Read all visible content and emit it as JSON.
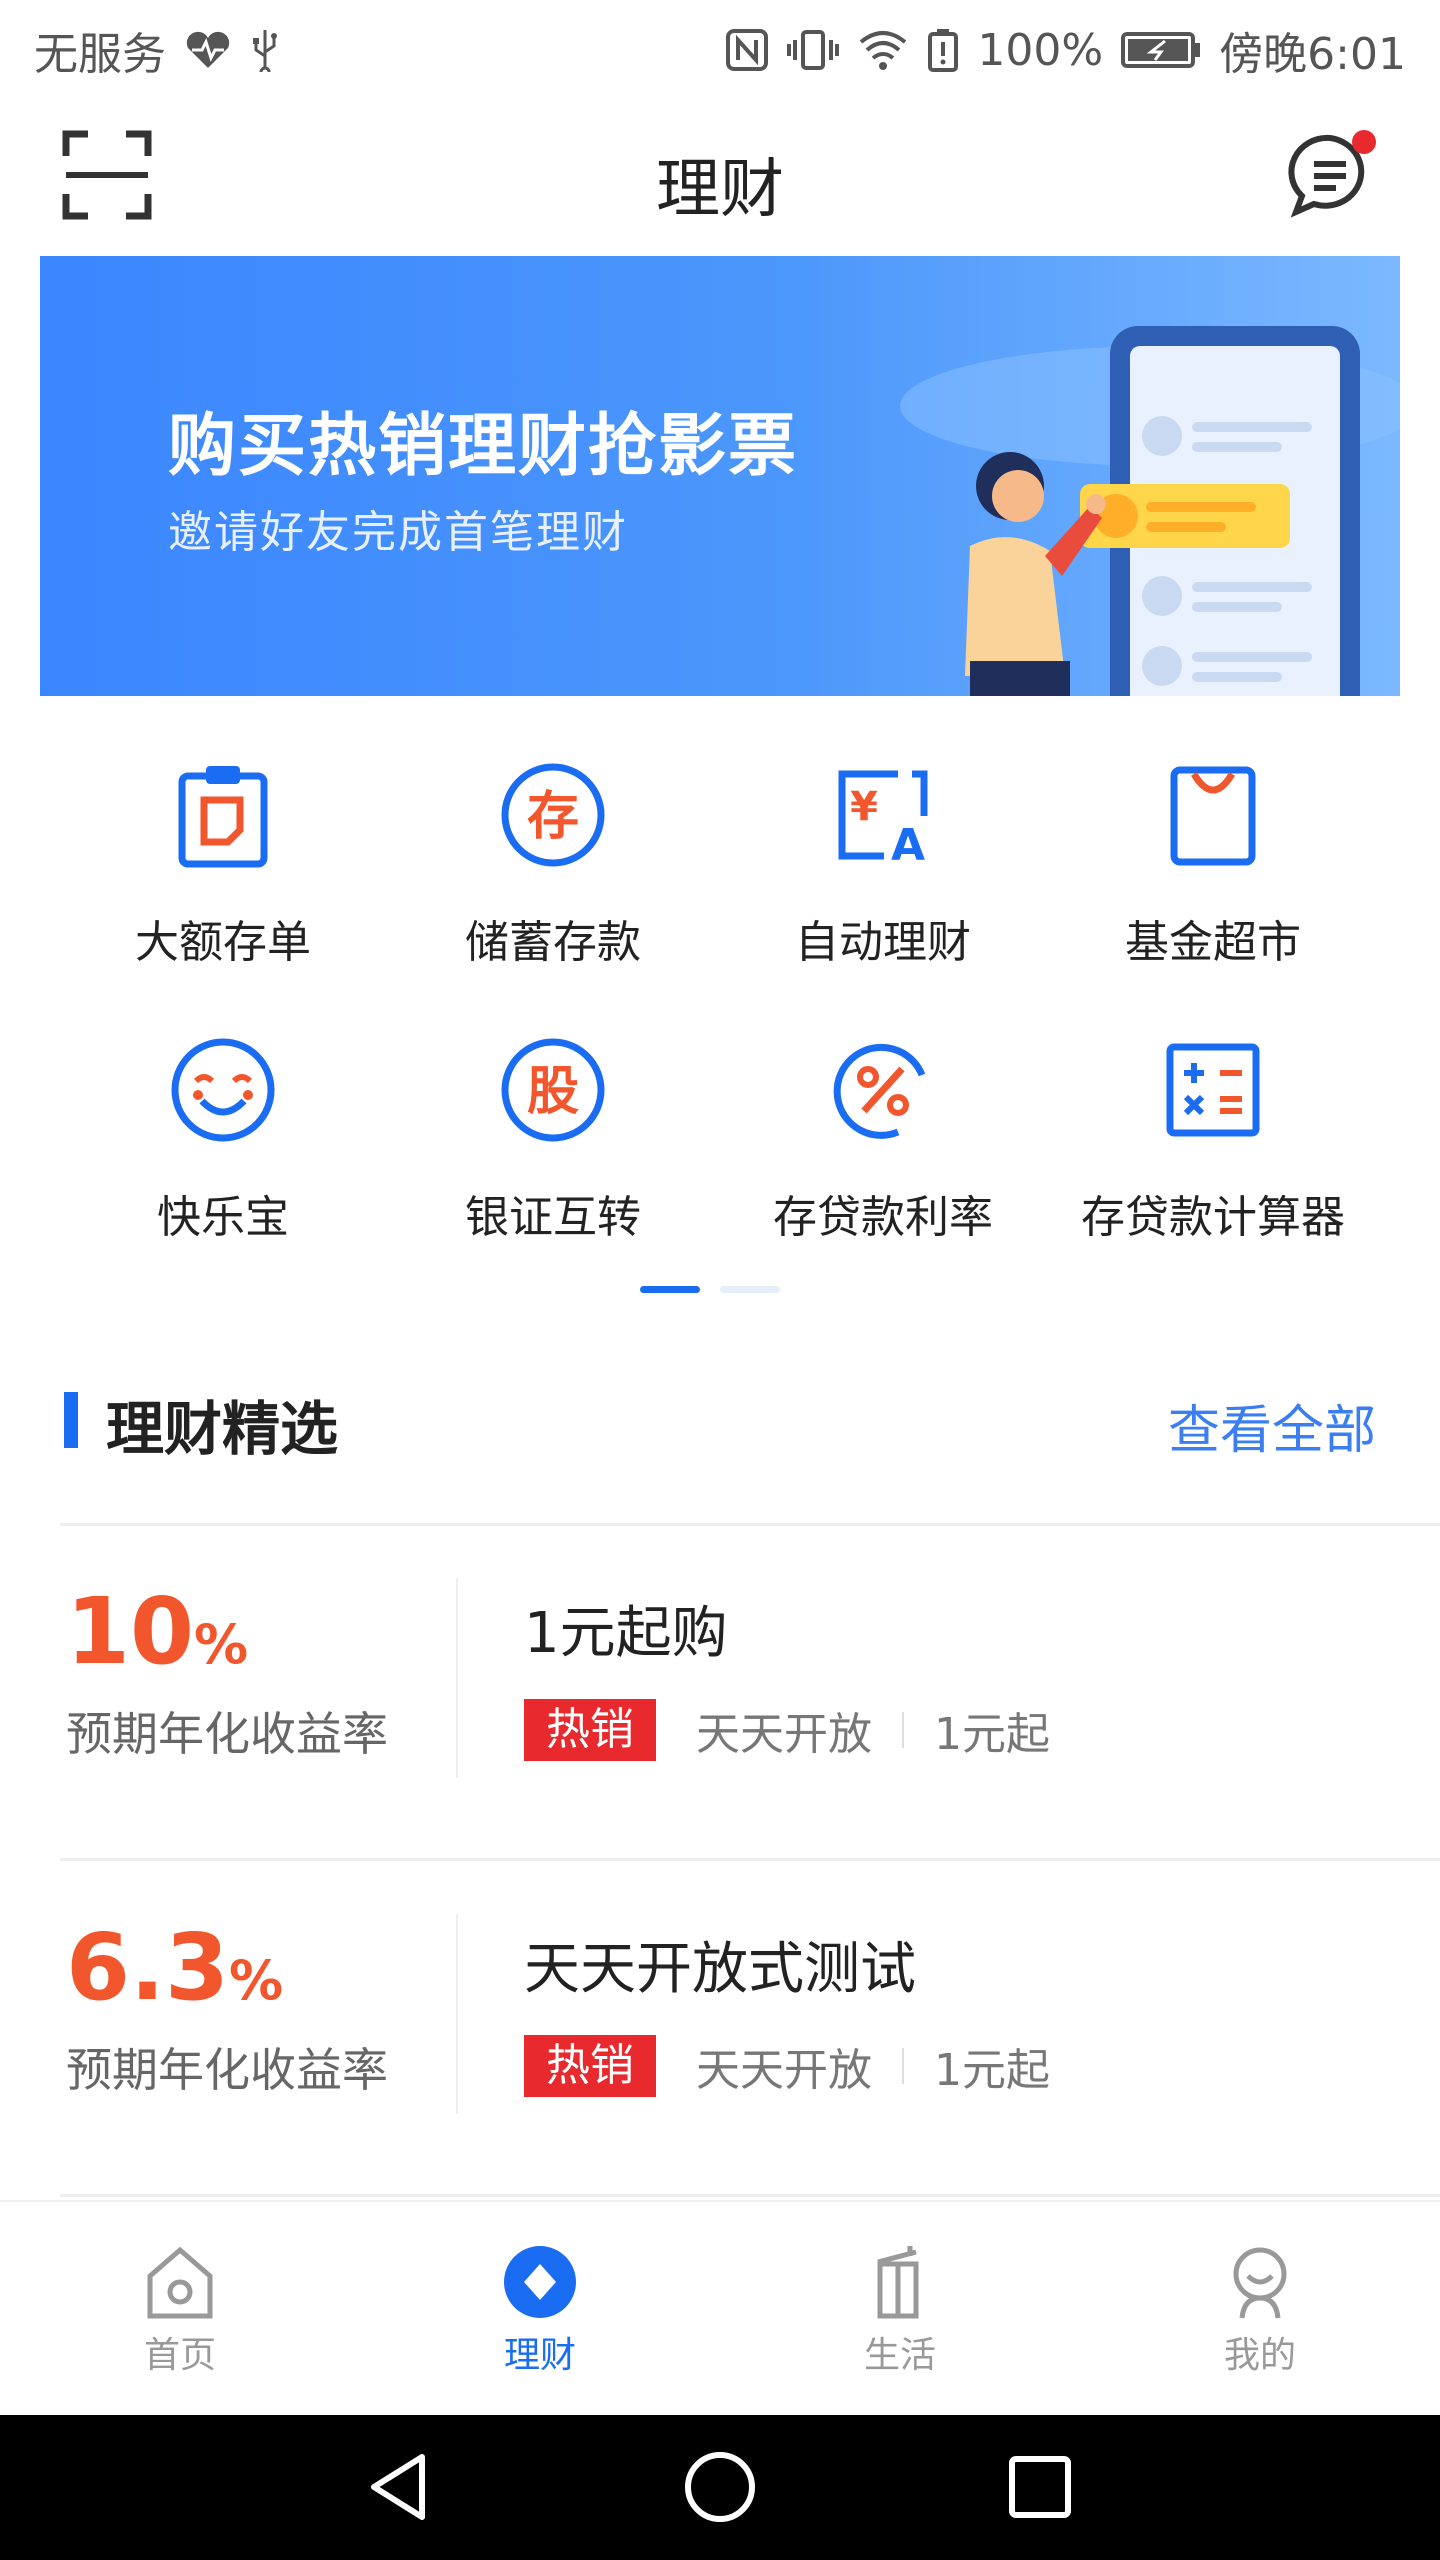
{
  "status_bar": {
    "carrier": "无服务",
    "battery": "100%",
    "time": "傍晚6:01"
  },
  "header": {
    "title": "理财"
  },
  "banner": {
    "title": "购买热销理财抢影票",
    "subtitle": "邀请好友完成首笔理财"
  },
  "quick_menu": [
    {
      "label": "大额存单",
      "icon": "certificate-deposit-icon"
    },
    {
      "label": "储蓄存款",
      "icon": "savings-deposit-icon"
    },
    {
      "label": "自动理财",
      "icon": "auto-finance-icon"
    },
    {
      "label": "基金超市",
      "icon": "fund-market-icon"
    },
    {
      "label": "快乐宝",
      "icon": "smiley-icon"
    },
    {
      "label": "银证互转",
      "icon": "stock-transfer-icon"
    },
    {
      "label": "存贷款利率",
      "icon": "interest-rate-icon"
    },
    {
      "label": "存贷款计算器",
      "icon": "calculator-icon"
    }
  ],
  "section": {
    "title": "理财精选",
    "more": "查看全部"
  },
  "products": [
    {
      "rate": "10",
      "rate_unit": "%",
      "rate_label": "预期年化收益率",
      "name": "1元起购",
      "tag": "热销",
      "open": "天天开放",
      "min": "1元起"
    },
    {
      "rate": "6.3",
      "rate_unit": "%",
      "rate_label": "预期年化收益率",
      "name": "天天开放式测试",
      "tag": "热销",
      "open": "天天开放",
      "min": "1元起"
    }
  ],
  "tabs": [
    {
      "label": "首页",
      "icon": "home-icon"
    },
    {
      "label": "理财",
      "icon": "finance-icon"
    },
    {
      "label": "生活",
      "icon": "life-icon"
    },
    {
      "label": "我的",
      "icon": "profile-icon"
    }
  ],
  "colors": {
    "primary": "#1a6cf2",
    "accent": "#f2562c",
    "hot": "#e8292d"
  }
}
